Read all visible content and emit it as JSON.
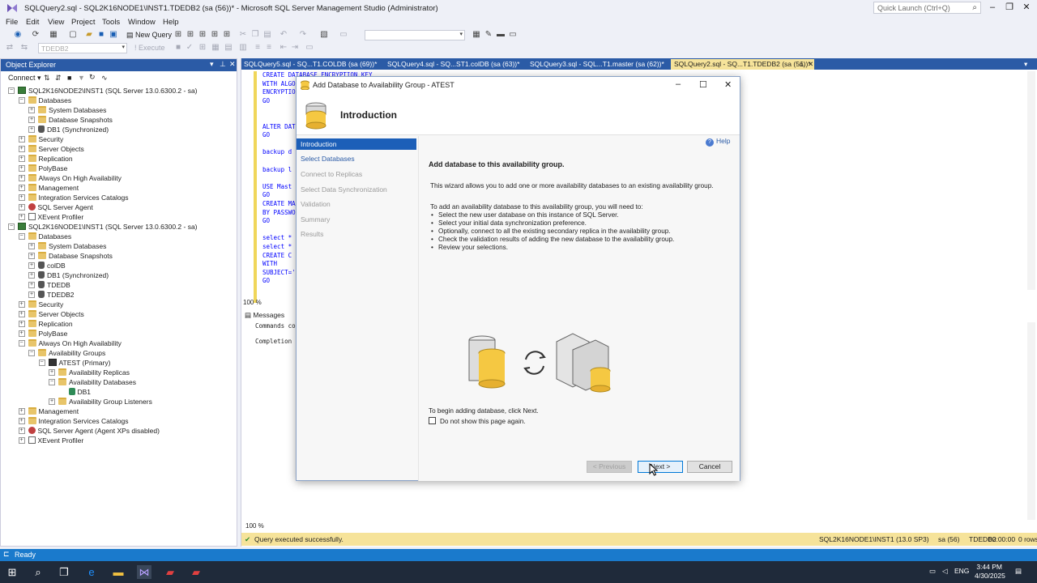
{
  "window": {
    "title": "SQLQuery2.sql - SQL2K16NODE1\\INST1.TDEDB2 (sa (56))* - Microsoft SQL Server Management Studio (Administrator)",
    "quick_launch_placeholder": "Quick Launch (Ctrl+Q)"
  },
  "menu": [
    "File",
    "Edit",
    "View",
    "Project",
    "Tools",
    "Window",
    "Help"
  ],
  "toolbar": {
    "new_query": "New Query",
    "db_combo": "TDEDB2",
    "execute": "Execute"
  },
  "object_explorer": {
    "title": "Object Explorer",
    "connect": "Connect",
    "tree": [
      {
        "label": "SQL2K16NODE2\\INST1 (SQL Server 13.0.6300.2 - sa)",
        "level": 0,
        "exp": "−",
        "icon": "server"
      },
      {
        "label": "Databases",
        "level": 1,
        "exp": "−",
        "icon": "folder"
      },
      {
        "label": "System Databases",
        "level": 2,
        "exp": "+",
        "icon": "folder"
      },
      {
        "label": "Database Snapshots",
        "level": 2,
        "exp": "+",
        "icon": "folder"
      },
      {
        "label": "DB1 (Synchronized)",
        "level": 2,
        "exp": "+",
        "icon": "db"
      },
      {
        "label": "Security",
        "level": 1,
        "exp": "+",
        "icon": "folder"
      },
      {
        "label": "Server Objects",
        "level": 1,
        "exp": "+",
        "icon": "folder"
      },
      {
        "label": "Replication",
        "level": 1,
        "exp": "+",
        "icon": "folder"
      },
      {
        "label": "PolyBase",
        "level": 1,
        "exp": "+",
        "icon": "folder"
      },
      {
        "label": "Always On High Availability",
        "level": 1,
        "exp": "+",
        "icon": "folder"
      },
      {
        "label": "Management",
        "level": 1,
        "exp": "+",
        "icon": "folder"
      },
      {
        "label": "Integration Services Catalogs",
        "level": 1,
        "exp": "+",
        "icon": "folder"
      },
      {
        "label": "SQL Server Agent",
        "level": 1,
        "exp": "+",
        "icon": "agent"
      },
      {
        "label": "XEvent Profiler",
        "level": 1,
        "exp": "+",
        "icon": "xe"
      },
      {
        "label": "SQL2K16NODE1\\INST1 (SQL Server 13.0.6300.2 - sa)",
        "level": 0,
        "exp": "−",
        "icon": "server"
      },
      {
        "label": "Databases",
        "level": 1,
        "exp": "−",
        "icon": "folder"
      },
      {
        "label": "System Databases",
        "level": 2,
        "exp": "+",
        "icon": "folder"
      },
      {
        "label": "Database Snapshots",
        "level": 2,
        "exp": "+",
        "icon": "folder"
      },
      {
        "label": "colDB",
        "level": 2,
        "exp": "+",
        "icon": "db"
      },
      {
        "label": "DB1 (Synchronized)",
        "level": 2,
        "exp": "+",
        "icon": "db"
      },
      {
        "label": "TDEDB",
        "level": 2,
        "exp": "+",
        "icon": "db"
      },
      {
        "label": "TDEDB2",
        "level": 2,
        "exp": "+",
        "icon": "db"
      },
      {
        "label": "Security",
        "level": 1,
        "exp": "+",
        "icon": "folder"
      },
      {
        "label": "Server Objects",
        "level": 1,
        "exp": "+",
        "icon": "folder"
      },
      {
        "label": "Replication",
        "level": 1,
        "exp": "+",
        "icon": "folder"
      },
      {
        "label": "PolyBase",
        "level": 1,
        "exp": "+",
        "icon": "folder"
      },
      {
        "label": "Always On High Availability",
        "level": 1,
        "exp": "−",
        "icon": "folder"
      },
      {
        "label": "Availability Groups",
        "level": 2,
        "exp": "−",
        "icon": "folder"
      },
      {
        "label": "ATEST (Primary)",
        "level": 3,
        "exp": "−",
        "icon": "ag"
      },
      {
        "label": "Availability Replicas",
        "level": 4,
        "exp": "+",
        "icon": "folder"
      },
      {
        "label": "Availability Databases",
        "level": 4,
        "exp": "−",
        "icon": "folder"
      },
      {
        "label": "DB1",
        "level": 5,
        "exp": "",
        "icon": "dbg"
      },
      {
        "label": "Availability Group Listeners",
        "level": 4,
        "exp": "+",
        "icon": "folder"
      },
      {
        "label": "Management",
        "level": 1,
        "exp": "+",
        "icon": "folder"
      },
      {
        "label": "Integration Services Catalogs",
        "level": 1,
        "exp": "+",
        "icon": "folder"
      },
      {
        "label": "SQL Server Agent (Agent XPs disabled)",
        "level": 1,
        "exp": "+",
        "icon": "agent"
      },
      {
        "label": "XEvent Profiler",
        "level": 1,
        "exp": "+",
        "icon": "xe"
      }
    ]
  },
  "doc_tabs": [
    {
      "label": "SQLQuery5.sql - SQ...T1.COLDB (sa (69))*",
      "active": false
    },
    {
      "label": "SQLQuery4.sql - SQ...ST1.colDB (sa (63))*",
      "active": false
    },
    {
      "label": "SQLQuery3.sql - SQL...T1.master (sa (62))*",
      "active": false
    },
    {
      "label": "SQLQuery2.sql - SQ...T1.TDEDB2 (sa (56))*",
      "active": true
    }
  ],
  "code_lines": [
    {
      "text": "CREATE DATABASE ENCRYPTION KEY",
      "cls": "kw"
    },
    {
      "text": "WITH ALGO",
      "cls": "kw"
    },
    {
      "text": "ENCRYPTIO",
      "cls": "kw"
    },
    {
      "text": "GO",
      "cls": "kw"
    },
    {
      "text": "",
      "cls": "cm"
    },
    {
      "text": "",
      "cls": "cm"
    },
    {
      "text": "ALTER DAT",
      "cls": "kw"
    },
    {
      "text": "GO",
      "cls": "kw"
    },
    {
      "text": "",
      "cls": "cm"
    },
    {
      "text": "backup d",
      "cls": "kw"
    },
    {
      "text": "",
      "cls": "cm"
    },
    {
      "text": "backup l",
      "cls": "kw"
    },
    {
      "text": "",
      "cls": "cm"
    },
    {
      "text": "USE Mast",
      "cls": "kw"
    },
    {
      "text": "GO",
      "cls": "kw"
    },
    {
      "text": "CREATE MA",
      "cls": "kw"
    },
    {
      "text": "BY PASSWO",
      "cls": "kw"
    },
    {
      "text": "GO",
      "cls": "kw"
    },
    {
      "text": "",
      "cls": "cm"
    },
    {
      "text": "select *",
      "cls": "kw"
    },
    {
      "text": "select *",
      "cls": "kw"
    },
    {
      "text": "CREATE C",
      "cls": "kw"
    },
    {
      "text": "WITH",
      "cls": "kw"
    },
    {
      "text": "SUBJECT='",
      "cls": "kw"
    },
    {
      "text": "GO",
      "cls": "kw"
    }
  ],
  "editor": {
    "zoom_top": "100 %",
    "messages_tab": "Messages",
    "messages": [
      "Commands co",
      "",
      "Completion"
    ],
    "zoom_bottom": "100 %",
    "status_ok": "Query executed successfully.",
    "status_server": "SQL2K16NODE1\\INST1 (13.0 SP3)",
    "status_user": "sa (56)",
    "status_db": "TDEDB2",
    "status_time": "00:00:00",
    "status_rows": "0 rows"
  },
  "statusbar": {
    "ready": "Ready"
  },
  "taskbar": {
    "lang": "ENG",
    "time": "3:44 PM",
    "date": "4/30/2025"
  },
  "dialog": {
    "title": "Add Database to Availability Group - ATEST",
    "header": "Introduction",
    "steps": [
      {
        "label": "Introduction",
        "state": "active"
      },
      {
        "label": "Select Databases",
        "state": "link"
      },
      {
        "label": "Connect to Replicas",
        "state": "disabled"
      },
      {
        "label": "Select Data Synchronization",
        "state": "disabled"
      },
      {
        "label": "Validation",
        "state": "disabled"
      },
      {
        "label": "Summary",
        "state": "disabled"
      },
      {
        "label": "Results",
        "state": "disabled"
      }
    ],
    "help": "Help",
    "content_title": "Add database to this availability group.",
    "description": "This wizard allows you to add one or more availability databases to an existing availability group.",
    "intro": "To add an availability database to this availability group, you will need to:",
    "bullets": [
      "Select the new user database on this instance of SQL Server.",
      "Select your initial data synchronization preference.",
      "Optionally, connect to all the existing secondary replica in the availability group.",
      "Check the validation results of adding the new database to the availability group.",
      "Review your selections."
    ],
    "begin_text": "To begin adding database, click Next.",
    "checkbox_label": "Do not show this page again.",
    "buttons": {
      "previous": "< Previous",
      "next": "Next >",
      "cancel": "Cancel"
    }
  }
}
